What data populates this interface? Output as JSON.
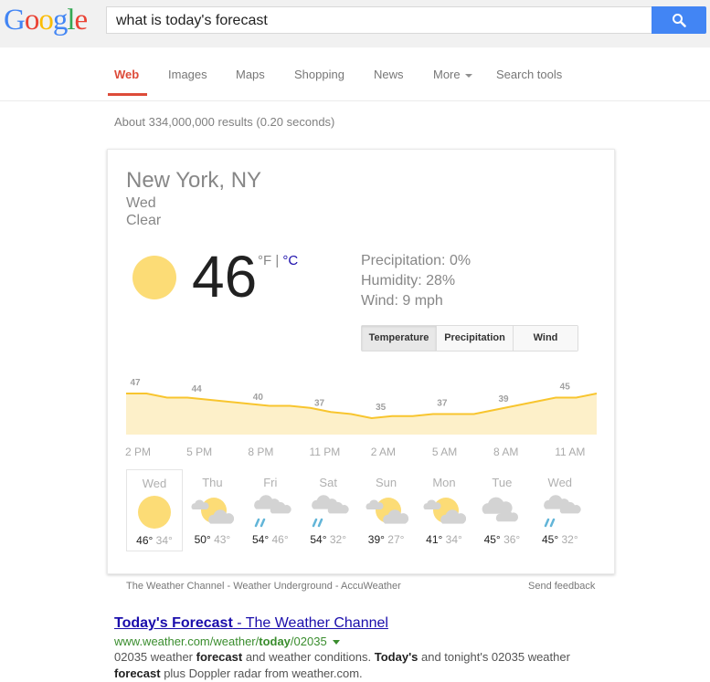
{
  "header": {
    "logo_letters": [
      {
        "ch": "G",
        "color": "#4285f4"
      },
      {
        "ch": "o",
        "color": "#ea4335"
      },
      {
        "ch": "o",
        "color": "#fbbc05"
      },
      {
        "ch": "g",
        "color": "#4285f4"
      },
      {
        "ch": "l",
        "color": "#34a853"
      },
      {
        "ch": "e",
        "color": "#ea4335"
      }
    ],
    "search_query": "what is today's forecast",
    "search_icon": "search-icon"
  },
  "nav": {
    "items": [
      {
        "label": "Web",
        "active": true
      },
      {
        "label": "Images"
      },
      {
        "label": "Maps"
      },
      {
        "label": "Shopping"
      },
      {
        "label": "News"
      },
      {
        "label": "More"
      },
      {
        "label": "Search tools"
      }
    ]
  },
  "stats": "About 334,000,000 results (0.20 seconds)",
  "weather": {
    "location": "New York, NY",
    "day": "Wed",
    "condition": "Clear",
    "current_icon": "sun-icon",
    "temperature": "46",
    "unit_f": "°F",
    "unit_sep": " | ",
    "unit_c": "°C",
    "precipitation": "Precipitation: 0%",
    "humidity": "Humidity: 28%",
    "wind": "Wind: 9 mph",
    "tabs": [
      {
        "label": "Temperature",
        "active": true
      },
      {
        "label": "Precipitation"
      },
      {
        "label": "Wind"
      }
    ],
    "hour_labels": [
      "2 PM",
      "5 PM",
      "8 PM",
      "11 PM",
      "2 AM",
      "5 AM",
      "8 AM",
      "11 AM"
    ],
    "forecast": [
      {
        "day": "Wed",
        "icon": "sunny",
        "hi": "46°",
        "lo": "34°",
        "selected": true
      },
      {
        "day": "Thu",
        "icon": "partly-cloudy",
        "hi": "50°",
        "lo": "43°"
      },
      {
        "day": "Fri",
        "icon": "rain",
        "hi": "54°",
        "lo": "46°"
      },
      {
        "day": "Sat",
        "icon": "rain",
        "hi": "54°",
        "lo": "32°"
      },
      {
        "day": "Sun",
        "icon": "partly-cloudy",
        "hi": "39°",
        "lo": "27°"
      },
      {
        "day": "Mon",
        "icon": "partly-cloudy",
        "hi": "41°",
        "lo": "34°"
      },
      {
        "day": "Tue",
        "icon": "cloudy",
        "hi": "45°",
        "lo": "36°"
      },
      {
        "day": "Wed",
        "icon": "rain",
        "hi": "45°",
        "lo": "32°"
      }
    ],
    "sources": "The Weather Channel - Weather Underground - AccuWeather",
    "feedback": "Send feedback",
    "colors": {
      "sun": "#fcdc76",
      "line": "#f8c52e",
      "area": "#fdf0c9",
      "cloud": "#d3d3d3",
      "rain": "#62b5d8"
    }
  },
  "chart_data": {
    "type": "area",
    "title": "Temperature",
    "x": [
      "2 PM",
      "3 PM",
      "4 PM",
      "5 PM",
      "6 PM",
      "7 PM",
      "8 PM",
      "9 PM",
      "10 PM",
      "11 PM",
      "12 AM",
      "1 AM",
      "2 AM",
      "3 AM",
      "4 AM",
      "5 AM",
      "6 AM",
      "7 AM",
      "8 AM",
      "9 AM",
      "10 AM",
      "11 AM",
      "12 PM",
      "1 PM"
    ],
    "values": [
      47,
      47,
      45,
      45,
      44,
      43,
      42,
      41,
      41,
      40,
      38,
      37,
      35,
      36,
      36,
      37,
      37,
      37,
      39,
      41,
      43,
      45,
      45,
      47
    ],
    "labels": [
      {
        "x": "2 PM",
        "value": 47
      },
      {
        "x": "5 PM",
        "value": 44
      },
      {
        "x": "8 PM",
        "value": 40
      },
      {
        "x": "11 PM",
        "value": 37
      },
      {
        "x": "2 AM",
        "value": 35
      },
      {
        "x": "5 AM",
        "value": 37
      },
      {
        "x": "8 AM",
        "value": 39
      },
      {
        "x": "11 AM",
        "value": 45
      }
    ],
    "tick_labels": [
      "2 PM",
      "5 PM",
      "8 PM",
      "11 PM",
      "2 AM",
      "5 AM",
      "8 AM",
      "11 AM"
    ],
    "ylim": [
      20,
      50
    ],
    "grid": false,
    "xlabel": "",
    "ylabel": ""
  },
  "result": {
    "title_bold": "Today's Forecast",
    "title_rest": " - The Weather Channel",
    "url_pre": "www.weather.com/weather/",
    "url_bold": "today",
    "url_post": "/02035",
    "snippet_parts": [
      {
        "t": "02035 weather "
      },
      {
        "t": "forecast",
        "b": true
      },
      {
        "t": " and weather conditions. "
      },
      {
        "t": "Today's",
        "b": true
      },
      {
        "t": " and tonight's 02035 weather "
      },
      {
        "t": "forecast",
        "b": true
      },
      {
        "t": " plus Doppler radar from weather.com."
      }
    ]
  }
}
